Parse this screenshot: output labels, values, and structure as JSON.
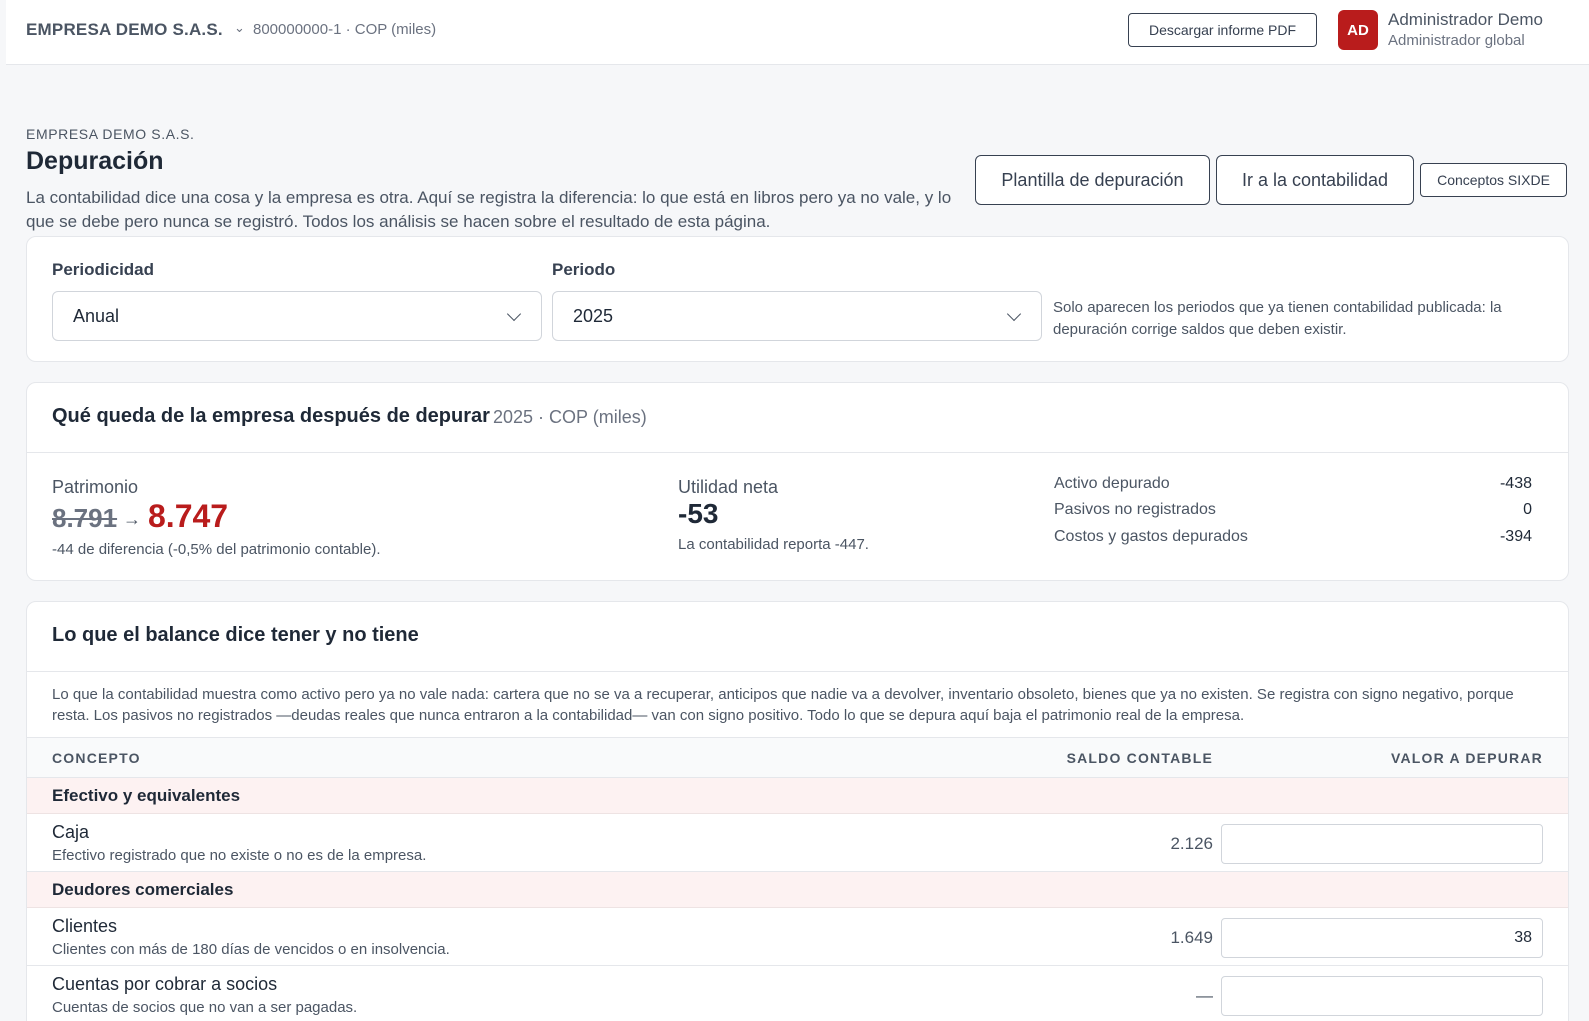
{
  "topbar": {
    "company": "EMPRESA DEMO S.A.S.",
    "company_meta": "800000000-1 · COP (miles)",
    "pdf_button": "Descargar informe PDF",
    "avatar_initials": "AD",
    "user_name": "Administrador Demo",
    "user_role": "Administrador global",
    "accent_color": "#b91c1c"
  },
  "header": {
    "eyebrow": "EMPRESA DEMO S.A.S.",
    "title": "Depuración",
    "description": "La contabilidad dice una cosa y la empresa es otra. Aquí se registra la diferencia: lo que está en libros pero ya no vale, y lo que se debe pero nunca se registró. Todos los análisis se hacen sobre el resultado de esta página.",
    "buttons": {
      "template": "Plantilla de depuración",
      "accounting": "Ir a la contabilidad",
      "sixde": "Conceptos SIXDE"
    }
  },
  "filters": {
    "periodicity_label": "Periodicidad",
    "periodicity_value": "Anual",
    "period_label": "Periodo",
    "period_value": "2025",
    "note": "Solo aparecen los periodos que ya tienen contabilidad publicada: la depuración corrige saldos que deben existir."
  },
  "summary": {
    "title": "Qué queda de la empresa después de depurar",
    "subtitle": "2025 · COP (miles)",
    "equity_label": "Patrimonio",
    "equity_old": "8.791",
    "equity_arrow": "→",
    "equity_new": "8.747",
    "equity_note": "-44 de diferencia (-0,5% del patrimonio contable).",
    "net_label": "Utilidad neta",
    "net_value": "-53",
    "net_note": "La contabilidad reporta -447.",
    "items": [
      {
        "label": "Activo depurado",
        "value": "-438"
      },
      {
        "label": "Pasivos no registrados",
        "value": "0"
      },
      {
        "label": "Costos y gastos depurados",
        "value": "-394"
      }
    ]
  },
  "balance": {
    "title": "Lo que el balance dice tener y no tiene",
    "description": "Lo que la contabilidad muestra como activo pero ya no vale nada: cartera que no se va a recuperar, anticipos que nadie va a devolver, inventario obsoleto, bienes que ya no existen. Se registra con signo negativo, porque resta. Los pasivos no registrados —deudas reales que nunca entraron a la contabilidad— van con signo positivo. Todo lo que se depura aquí baja el patrimonio real de la empresa.",
    "columns": {
      "concept": "CONCEPTO",
      "book": "SALDO CONTABLE",
      "adjust": "VALOR A DEPURAR"
    },
    "groups": [
      {
        "name": "Efectivo y equivalentes"
      },
      {
        "name": "Deudores comerciales"
      }
    ],
    "rows": [
      {
        "name": "Caja",
        "desc": "Efectivo registrado que no existe o no es de la empresa.",
        "saldo": "2.126",
        "value": ""
      },
      {
        "name": "Clientes",
        "desc": "Clientes con más de 180 días de vencidos o en insolvencia.",
        "saldo": "1.649",
        "value": "38"
      },
      {
        "name": "Cuentas por cobrar a socios",
        "desc": "Cuentas de socios que no van a ser pagadas.",
        "saldo": "—",
        "value": ""
      }
    ]
  }
}
